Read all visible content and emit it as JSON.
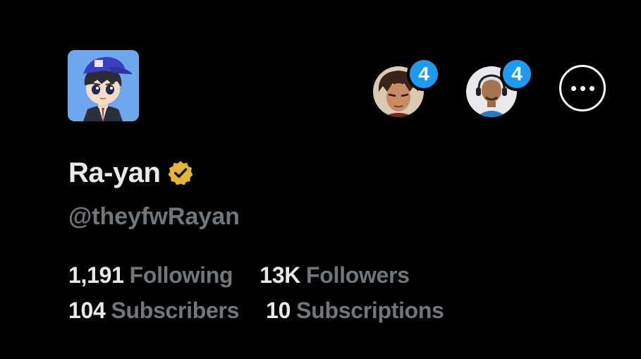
{
  "profile": {
    "display_name": "Ra-yan",
    "handle": "@theyfwRayan",
    "verified_badge_color": "#e8b530",
    "avatar_icon": "cartoon-avatar-blue-cap"
  },
  "header": {
    "stories": [
      {
        "count": "4",
        "icon": "story-avatar-anime"
      },
      {
        "count": "4",
        "icon": "story-avatar-person"
      }
    ],
    "more_icon": "more-options-icon",
    "badge_color": "#1d9bf0"
  },
  "stats": {
    "following_count": "1,191",
    "following_label": "Following",
    "followers_count": "13K",
    "followers_label": "Followers",
    "subscribers_count": "104",
    "subscribers_label": "Subscribers",
    "subscriptions_count": "10",
    "subscriptions_label": "Subscriptions"
  }
}
